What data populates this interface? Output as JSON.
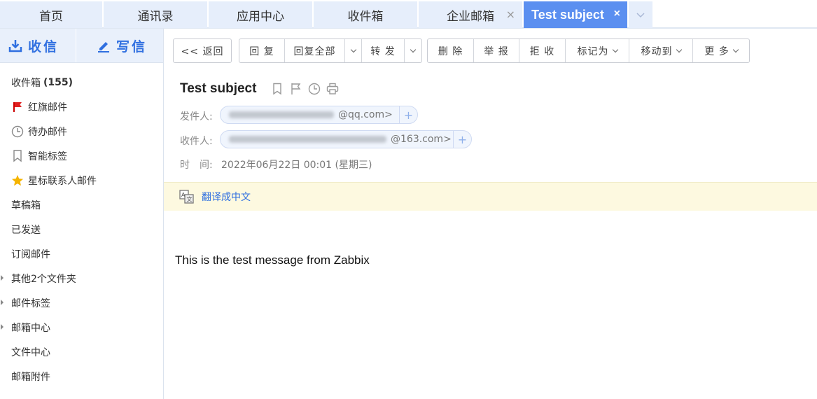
{
  "tabs": [
    {
      "label": "首页"
    },
    {
      "label": "通讯录"
    },
    {
      "label": "应用中心"
    },
    {
      "label": "收件箱"
    },
    {
      "label": "企业邮箱"
    },
    {
      "label": "Test subject"
    }
  ],
  "tab_close_glyph": "×",
  "sidebar": {
    "receive_label": "收信",
    "write_label": "写信",
    "items": [
      {
        "label": "收件箱",
        "count": "(155)",
        "icon": "none"
      },
      {
        "label": "红旗邮件",
        "icon": "red-flag-icon"
      },
      {
        "label": "待办邮件",
        "icon": "clock-icon"
      },
      {
        "label": "智能标签",
        "icon": "bookmark-icon"
      },
      {
        "label": "星标联系人邮件",
        "icon": "star-icon"
      },
      {
        "label": "草稿箱"
      },
      {
        "label": "已发送"
      },
      {
        "label": "订阅邮件"
      },
      {
        "label": "其他2个文件夹",
        "expandable": true
      },
      {
        "label": "邮件标签",
        "expandable": true
      },
      {
        "label": "邮箱中心",
        "expandable": true
      },
      {
        "label": "文件中心"
      },
      {
        "label": "邮箱附件"
      }
    ]
  },
  "toolbar": {
    "back": "<< 返回",
    "reply": "回 复",
    "reply_all": "回复全部",
    "forward": "转 发",
    "delete": "删 除",
    "report": "举 报",
    "reject": "拒 收",
    "mark_as": "标记为",
    "move_to": "移动到",
    "more": "更 多"
  },
  "message": {
    "subject": "Test subject",
    "from_label": "发件人:",
    "from_visible": "@qq.com>",
    "to_label": "收件人:",
    "to_visible": "@163.com>",
    "time_label": "时　间:",
    "time_value": "2022年06月22日 00:01 (星期三)",
    "translate_label": "翻译成中文",
    "body": "This is the test message from Zabbix"
  },
  "colors": {
    "accent": "#2f6fe0",
    "active_tab": "#5b8ff0",
    "tab_bg": "#e6eefb",
    "translate_bar": "#fdf9e0"
  }
}
